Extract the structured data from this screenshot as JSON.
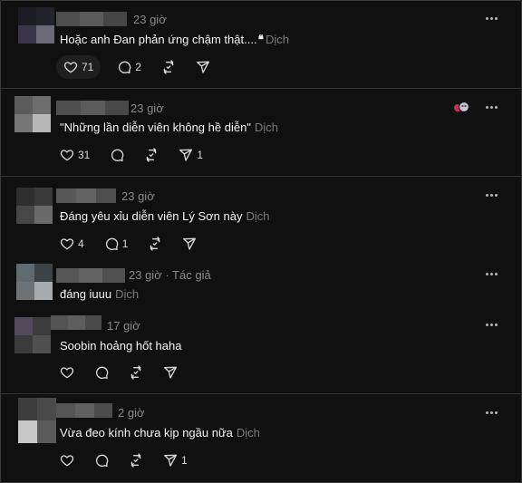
{
  "comments": [
    {
      "time": "23 giờ",
      "author_tag": "",
      "text": "Hoặc anh Đan phản ứng chậm thật....",
      "quote_emoji": "❛❛",
      "translate": "Dịch",
      "likes": "71",
      "replies": "2",
      "reposts": "",
      "shares": "",
      "like_highlight": true
    },
    {
      "time": "23 giờ",
      "author_tag": "",
      "text": "\"Những lần diễn viên không hề diễn\"",
      "translate": "Dịch",
      "likes": "31",
      "replies": "",
      "reposts": "",
      "shares": "1"
    },
    {
      "time": "23 giờ",
      "author_tag": "",
      "text": "Đáng yêu xỉu diễn viên Lý Sơn này",
      "translate": "Dịch",
      "likes": "4",
      "replies": "1",
      "reposts": "",
      "shares": ""
    },
    {
      "time": "23 giờ",
      "author_tag": "· Tác giả",
      "text": "đáng iuuu",
      "translate": "Dịch"
    },
    {
      "time": "17 giờ",
      "author_tag": "",
      "text": "Soobin hoảng hốt haha",
      "translate": "",
      "likes": "",
      "replies": "",
      "reposts": "",
      "shares": ""
    },
    {
      "time": "2 giờ",
      "author_tag": "",
      "text": "Vừa đeo kính chưa kịp ngầu nữa",
      "translate": "Dịch",
      "likes": "",
      "replies": "",
      "reposts": "",
      "shares": "1"
    }
  ],
  "icons": {
    "like": "heart-icon",
    "reply": "comment-icon",
    "repost": "repost-icon",
    "share": "send-icon",
    "more": "more-options-icon",
    "reaction": "reaction-badge-icon"
  },
  "colors": {
    "background": "#101010",
    "text": "#f3f5f7",
    "muted": "#8a8a8a",
    "divider": "#323232",
    "reaction_red": "#e0245e"
  }
}
